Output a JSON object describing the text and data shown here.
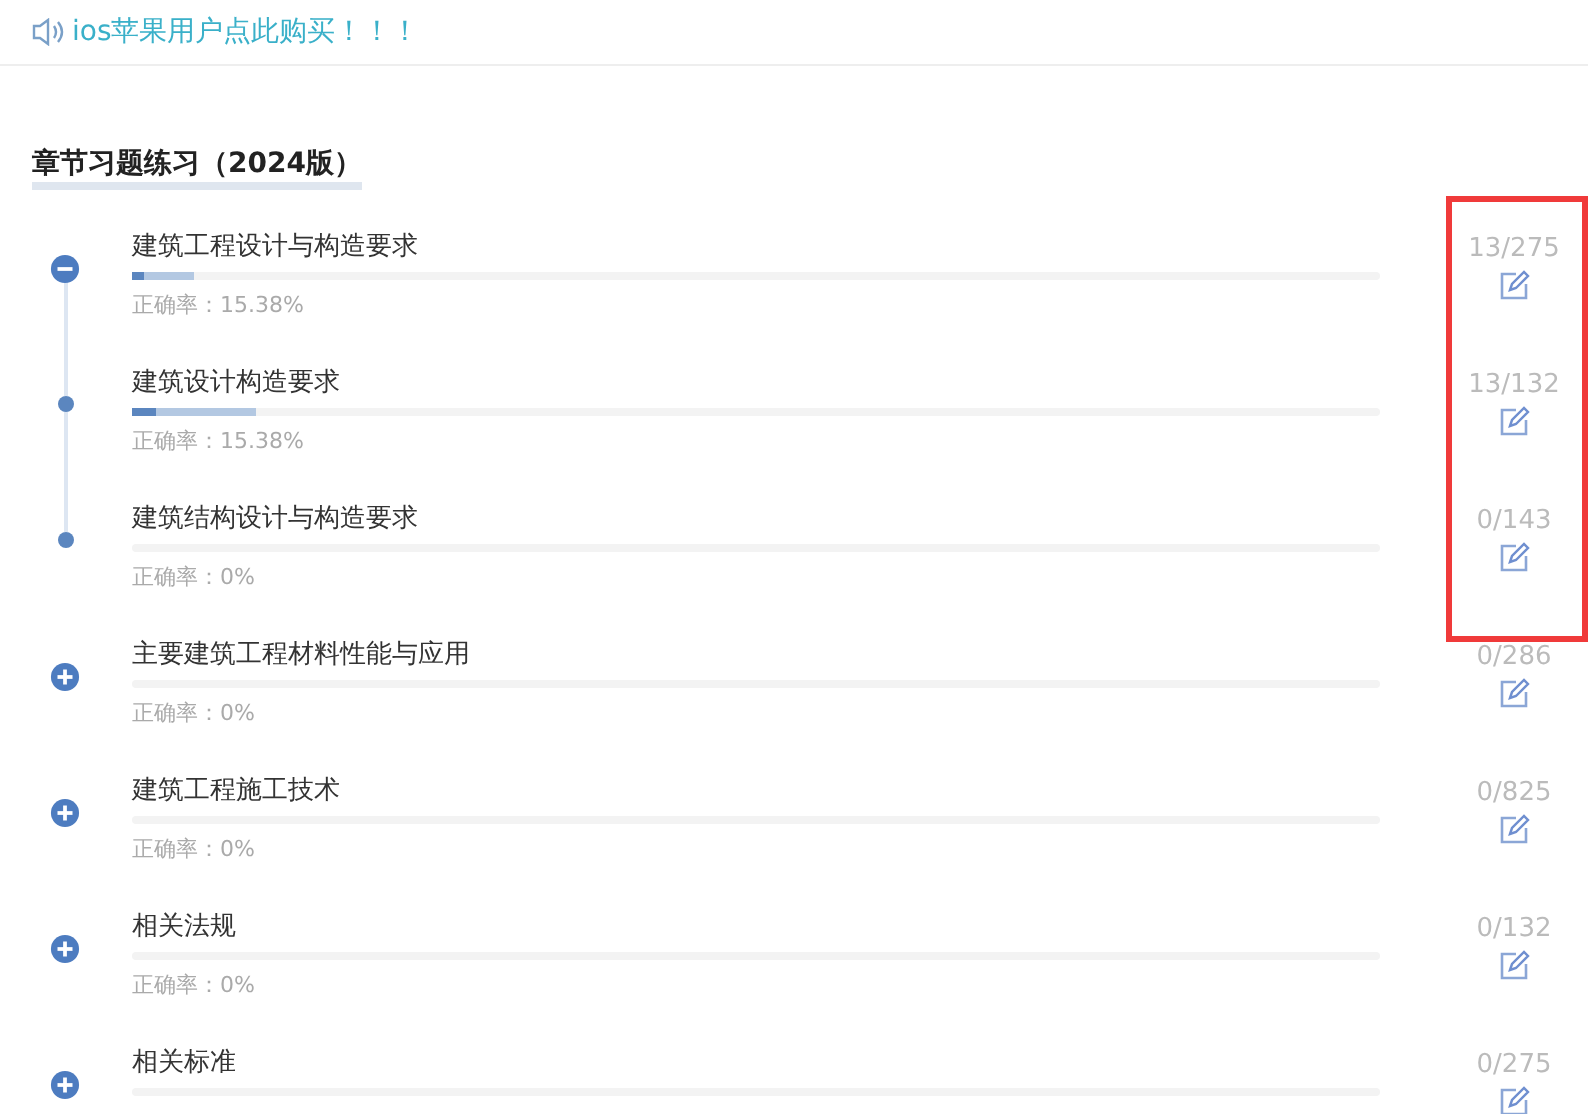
{
  "banner": {
    "text": "ios苹果用户点此购买！！！"
  },
  "heading": "章节习题练习（2024版）",
  "chapters": [
    {
      "title": "建筑工程设计与构造要求",
      "expanded": true,
      "highlighted": true,
      "accuracy": "正确率：15.38%",
      "count": "13/275",
      "progress": {
        "level": 0.05,
        "correct": {
          "level": 0.01
        }
      },
      "children": [
        {
          "title": "建筑设计构造要求",
          "accuracy": "正确率：15.38%",
          "count": "13/132",
          "progress": {
            "level": 0.1,
            "correct": {
              "level": 0.02
            }
          }
        },
        {
          "title": "建筑结构设计与构造要求",
          "accuracy": "正确率：0%",
          "count": "0/143"
        }
      ]
    },
    {
      "title": "主要建筑工程材料性能与应用",
      "expanded": false,
      "accuracy": "正确率：0%",
      "count": "0/286"
    },
    {
      "title": "建筑工程施工技术",
      "expanded": false,
      "accuracy": "正确率：0%",
      "count": "0/825"
    },
    {
      "title": "相关法规",
      "expanded": false,
      "accuracy": "正确率：0%",
      "count": "0/132"
    },
    {
      "title": "相关标准",
      "expanded": false,
      "count": "0/275"
    }
  ]
}
